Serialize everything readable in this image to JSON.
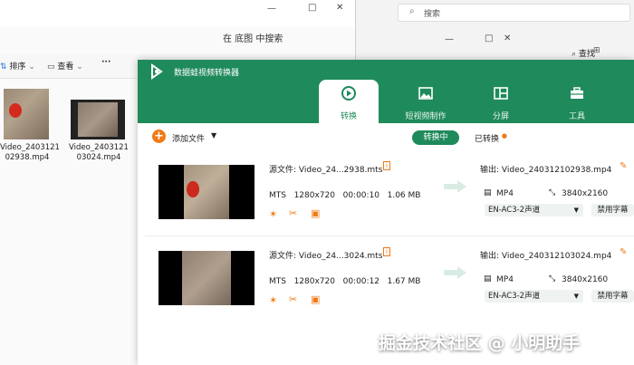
{
  "bg_left": {
    "search_text": "在 底图 中搜索",
    "toolbar": {
      "sort_label": "排序",
      "view_label": "查看",
      "more_label": "···"
    },
    "files": [
      {
        "name_line1": "Video_2403121",
        "name_line2": "02938.mp4"
      },
      {
        "name_line1": "Video_2403121",
        "name_line2": "03024.mp4"
      }
    ]
  },
  "bg_right": {
    "search_placeholder": "搜索",
    "find_label": "查找"
  },
  "app": {
    "title": "数据蛙视频转换器",
    "tabs": [
      {
        "label": "转换",
        "active": true
      },
      {
        "label": "短视频制作",
        "active": false
      },
      {
        "label": "分屏",
        "active": false
      },
      {
        "label": "工具",
        "active": false
      }
    ],
    "toolbar": {
      "add_file_label": "添加文件",
      "converting_label": "转换中",
      "converted_label": "已转换"
    },
    "items": [
      {
        "source_label": "源文件: Video_24...2938.mts",
        "format": "MTS",
        "resolution": "1280x720",
        "duration": "00:00:10",
        "size": "1.06 MB",
        "output_label": "输出: Video_240312102938.mp4",
        "out_format": "MP4",
        "out_resolution": "3840x2160",
        "audio": "EN-AC3-2声道",
        "subtitle": "禁用字幕"
      },
      {
        "source_label": "源文件: Video_24...3024.mts",
        "format": "MTS",
        "resolution": "1280x720",
        "duration": "00:00:12",
        "size": "1.67 MB",
        "output_label": "输出: Video_240312103024.mp4",
        "out_format": "MP4",
        "out_resolution": "3840x2160",
        "audio": "EN-AC3-2声道",
        "subtitle": "禁用字幕"
      }
    ]
  },
  "watermark": "掘金技术社区 @ 小明助手",
  "colors": {
    "brand_green": "#1f8a5b",
    "accent_orange": "#f07a16"
  }
}
